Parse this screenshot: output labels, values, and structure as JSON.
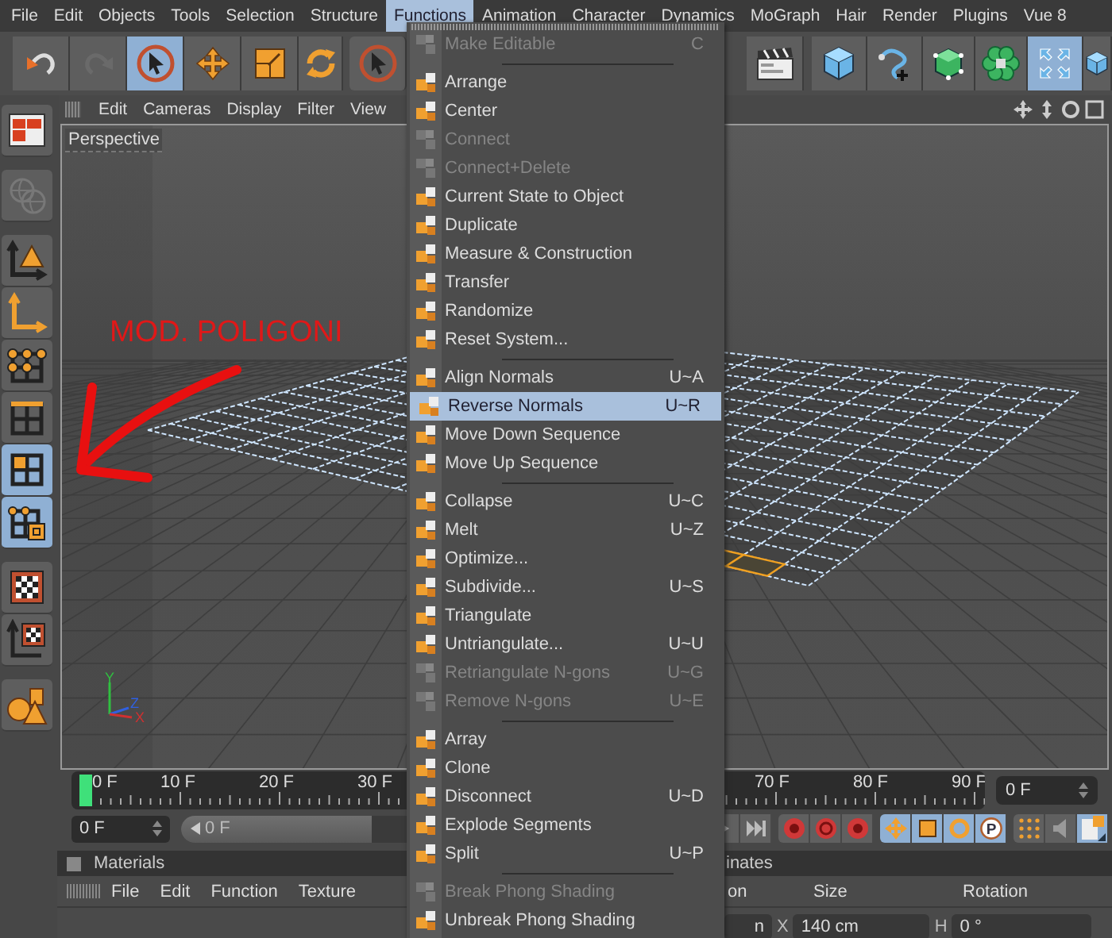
{
  "menubar": [
    {
      "label": "File",
      "selected": false
    },
    {
      "label": "Edit",
      "selected": false
    },
    {
      "label": "Objects",
      "selected": false
    },
    {
      "label": "Tools",
      "selected": false
    },
    {
      "label": "Selection",
      "selected": false
    },
    {
      "label": "Structure",
      "selected": false
    },
    {
      "label": "Functions",
      "selected": true
    },
    {
      "label": "Animation",
      "selected": false
    },
    {
      "label": "Character",
      "selected": false
    },
    {
      "label": "Dynamics",
      "selected": false
    },
    {
      "label": "MoGraph",
      "selected": false
    },
    {
      "label": "Hair",
      "selected": false
    },
    {
      "label": "Render",
      "selected": false
    },
    {
      "label": "Plugins",
      "selected": false
    },
    {
      "label": "Vue 8",
      "selected": false
    }
  ],
  "toolbar": {
    "left": [
      {
        "selected": false,
        "disabled": false
      },
      {
        "selected": false,
        "disabled": true
      },
      {
        "selected": true,
        "disabled": false
      },
      {
        "selected": false,
        "disabled": false
      },
      {
        "selected": false,
        "disabled": false
      },
      {
        "selected": false,
        "disabled": false
      },
      {
        "selected": false,
        "disabled": false
      }
    ],
    "right": [
      {
        "selected": false,
        "disabled": false
      },
      {
        "selected": false,
        "disabled": false
      },
      {
        "selected": false,
        "disabled": false
      },
      {
        "selected": false,
        "disabled": false
      },
      {
        "selected": false,
        "disabled": false
      },
      {
        "selected": true,
        "disabled": false
      },
      {
        "selected": false,
        "disabled": false
      }
    ]
  },
  "sidebar": [
    {
      "selected": false,
      "disabled": false
    },
    {
      "selected": false,
      "disabled": true
    },
    {
      "selected": false,
      "disabled": false
    },
    {
      "selected": false,
      "disabled": false
    },
    {
      "selected": false,
      "disabled": false
    },
    {
      "selected": false,
      "disabled": false
    },
    {
      "selected": true,
      "disabled": false
    },
    {
      "selected": true,
      "disabled": false
    },
    {
      "selected": false,
      "disabled": false
    },
    {
      "selected": false,
      "disabled": false
    },
    {
      "selected": false,
      "disabled": false
    }
  ],
  "viewport": {
    "menu": [
      "Edit",
      "Cameras",
      "Display",
      "Filter",
      "View"
    ],
    "camera": "Perspective",
    "annotation": "MOD. POLIGONI",
    "axes": [
      "Y",
      "Z",
      "X"
    ]
  },
  "timeline": {
    "ruler_left": [
      "0 F",
      "10 F",
      "20 F",
      "30 F"
    ],
    "ruler_right": [
      "70 F",
      "80 F",
      "90 F"
    ],
    "end_field": "0 F",
    "start_field": "0 F",
    "frame_slider": {
      "value": "0 F",
      "level": 0
    }
  },
  "playback": [
    {
      "selected": false
    },
    {
      "selected": false
    },
    {
      "selected": false
    },
    {
      "selected": false
    },
    {
      "selected": false
    },
    {
      "selected": true
    },
    {
      "selected": true
    },
    {
      "selected": true
    },
    {
      "selected": true,
      "label": "P"
    },
    {
      "selected": false
    },
    {
      "selected": false
    },
    {
      "selected": true
    }
  ],
  "materials": {
    "title": "Materials",
    "menu": [
      "File",
      "Edit",
      "Function",
      "Texture"
    ]
  },
  "coordinates": {
    "title": "inates",
    "columns": [
      "on",
      "Size",
      "Rotation"
    ],
    "fields": [
      {
        "value": "n"
      },
      {
        "axis": "X",
        "value": "140 cm"
      },
      {
        "axis": "H",
        "value": "0 °"
      }
    ]
  },
  "functions_menu": {
    "items": [
      {
        "kind": "item",
        "label": "Make Editable",
        "shortcut": "C",
        "disabled": true,
        "selected": false
      },
      {
        "kind": "separator"
      },
      {
        "kind": "item",
        "label": "Arrange",
        "disabled": false,
        "selected": false
      },
      {
        "kind": "item",
        "label": "Center",
        "disabled": false,
        "selected": false
      },
      {
        "kind": "item",
        "label": "Connect",
        "disabled": true,
        "selected": false
      },
      {
        "kind": "item",
        "label": "Connect+Delete",
        "disabled": true,
        "selected": false
      },
      {
        "kind": "item",
        "label": "Current State to Object",
        "disabled": false,
        "selected": false
      },
      {
        "kind": "item",
        "label": "Duplicate",
        "disabled": false,
        "selected": false
      },
      {
        "kind": "item",
        "label": "Measure & Construction",
        "disabled": false,
        "selected": false
      },
      {
        "kind": "item",
        "label": "Transfer",
        "disabled": false,
        "selected": false
      },
      {
        "kind": "item",
        "label": "Randomize",
        "disabled": false,
        "selected": false
      },
      {
        "kind": "item",
        "label": "Reset System...",
        "disabled": false,
        "selected": false
      },
      {
        "kind": "separator"
      },
      {
        "kind": "item",
        "label": "Align Normals",
        "shortcut": "U~A",
        "disabled": false,
        "selected": false
      },
      {
        "kind": "item",
        "label": "Reverse Normals",
        "shortcut": "U~R",
        "disabled": false,
        "selected": true
      },
      {
        "kind": "item",
        "label": "Move Down Sequence",
        "disabled": false,
        "selected": false
      },
      {
        "kind": "item",
        "label": "Move Up Sequence",
        "disabled": false,
        "selected": false
      },
      {
        "kind": "separator"
      },
      {
        "kind": "item",
        "label": "Collapse",
        "shortcut": "U~C",
        "disabled": false,
        "selected": false
      },
      {
        "kind": "item",
        "label": "Melt",
        "shortcut": "U~Z",
        "disabled": false,
        "selected": false
      },
      {
        "kind": "item",
        "label": "Optimize...",
        "disabled": false,
        "selected": false
      },
      {
        "kind": "item",
        "label": "Subdivide...",
        "shortcut": "U~S",
        "disabled": false,
        "selected": false
      },
      {
        "kind": "item",
        "label": "Triangulate",
        "disabled": false,
        "selected": false
      },
      {
        "kind": "item",
        "label": "Untriangulate...",
        "shortcut": "U~U",
        "disabled": false,
        "selected": false
      },
      {
        "kind": "item",
        "label": "Retriangulate N-gons",
        "shortcut": "U~G",
        "disabled": true,
        "selected": false
      },
      {
        "kind": "item",
        "label": "Remove N-gons",
        "shortcut": "U~E",
        "disabled": true,
        "selected": false
      },
      {
        "kind": "separator"
      },
      {
        "kind": "item",
        "label": "Array",
        "disabled": false,
        "selected": false
      },
      {
        "kind": "item",
        "label": "Clone",
        "disabled": false,
        "selected": false
      },
      {
        "kind": "item",
        "label": "Disconnect",
        "shortcut": "U~D",
        "disabled": false,
        "selected": false
      },
      {
        "kind": "item",
        "label": "Explode Segments",
        "disabled": false,
        "selected": false
      },
      {
        "kind": "item",
        "label": "Split",
        "shortcut": "U~P",
        "disabled": false,
        "selected": false
      },
      {
        "kind": "separator"
      },
      {
        "kind": "item",
        "label": "Break Phong Shading",
        "disabled": true,
        "selected": false
      },
      {
        "kind": "item",
        "label": "Unbreak Phong Shading",
        "disabled": false,
        "selected": false
      }
    ]
  }
}
